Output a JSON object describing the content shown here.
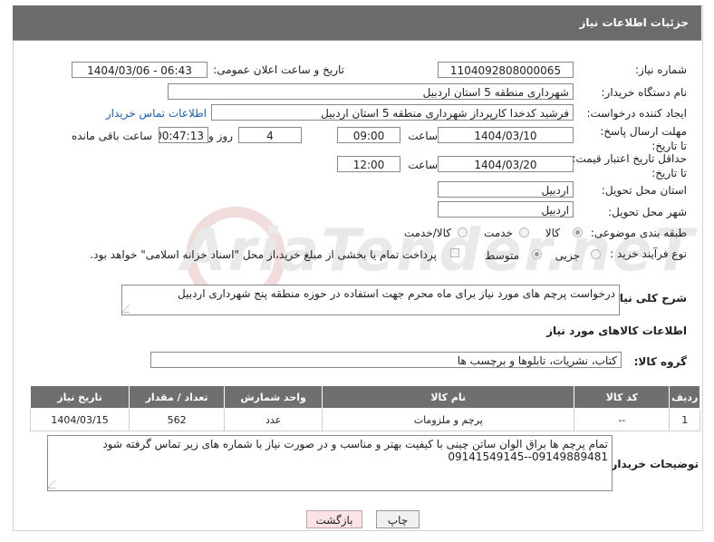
{
  "header": {
    "title": "جزئیات اطلاعات نیاز"
  },
  "fields": {
    "need_number_label": "شماره نیاز:",
    "need_number": "1104092808000065",
    "announce_label": "تاریخ و ساعت اعلان عمومی:",
    "announce_value": "1404/03/06 - 06:43",
    "buyer_org_label": "نام دستگاه خریدار:",
    "buyer_org": "شهرداری منطقه 5 استان  اردبیل",
    "creator_label": "ایجاد کننده درخواست:",
    "creator": "فرشید کدخدا کارپرداز شهرداری منطقه 5 استان  اردبیل",
    "contact_link": "اطلاعات تماس خریدار",
    "deadline_label": "مهلت ارسال پاسخ: تا تاریخ:",
    "deadline_date": "1404/03/10",
    "time_label": "ساعت",
    "deadline_time": "09:00",
    "days_value": "4",
    "days_label": "روز و",
    "remaining_time": "00:47:13",
    "remaining_label": "ساعت باقی مانده",
    "min_price_label": "حداقل تاریخ اعتبار قیمت: تا تاریخ:",
    "min_price_date": "1404/03/20",
    "min_price_time": "12:00",
    "province_label": "استان محل تحویل:",
    "province": "اردبیل",
    "city_label": "شهر محل تحویل:",
    "city": "اردبیل",
    "category_label": "طبقه بندی موضوعی:",
    "category_options": [
      "کالا",
      "خدمت",
      "کالا/خدمت"
    ],
    "process_label": "نوع فرآیند خرید :",
    "process_options": [
      "جزیی",
      "متوسط"
    ],
    "payment_note": "پرداخت تمام یا بخشی از مبلغ خرید،از محل \"اسناد خزانه اسلامی\" خواهد بود."
  },
  "description": {
    "label": "شرح کلی نیاز:",
    "text": "درخواست پرچم های مورد نیاز برای ماه محرم جهت استفاده در حوزه منطقه پنج شهرداری اردبیل"
  },
  "goods": {
    "section_title": "اطلاعات کالاهای مورد نیاز",
    "group_label": "گروه کالا:",
    "group_value": "کتاب، نشریات، تابلوها و برچسب ها",
    "columns": [
      "ردیف",
      "کد کالا",
      "نام کالا",
      "واحد شمارش",
      "تعداد / مقدار",
      "تاریخ نیاز"
    ],
    "rows": [
      {
        "row": "1",
        "code": "--",
        "name": "پرچم و ملزومات",
        "unit": "عدد",
        "qty": "562",
        "date": "1404/03/15"
      }
    ]
  },
  "buyer_notes": {
    "label": "توضیحات خریدار:",
    "line1": "تمام پرچم ها براق الوان ساتن چینی با کیفیت بهتر و مناسب و در صورت نیاز با شماره های زیر تماس گرفته شود",
    "line2": "09149889481--09141549145"
  },
  "buttons": {
    "print": "چاپ",
    "back": "بازگشت"
  },
  "watermark": "AriaTender.neT"
}
